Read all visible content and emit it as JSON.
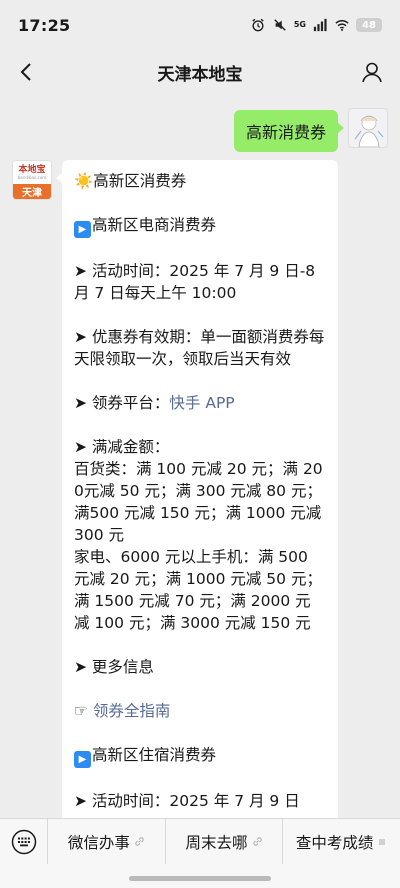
{
  "status": {
    "time": "17:25",
    "signal": "5G",
    "battery": "48"
  },
  "nav": {
    "title": "天津本地宝"
  },
  "outgoing": {
    "text": "高新消费券"
  },
  "bot_avatar": {
    "brand": "本地宝",
    "brand_sub": "bendibao.com",
    "city": "天津"
  },
  "message": {
    "p1": "☀️高新区消费券",
    "p2": "高新区电商消费券",
    "p3": "➤ 活动时间：2025 年 7 月 9 日-8 月 7 日每天上午 10:00",
    "p4": "➤ 优惠券有效期：单一面额消费券每天限领取一次，领取后当天有效",
    "p5_prefix": "➤ 领券平台：",
    "p5_link": "快手 APP",
    "p6_title": "➤ 满减金额：",
    "p6_line1": "百货类：满 100 元减 20 元；满 200元减 50 元；满 300 元减 80 元；满500 元减 150 元；满 1000 元减 300 元",
    "p6_line2": "家电、6000 元以上手机：满 500 元减 20 元；满 1000 元减 50 元；满 1500 元减 70 元；满 2000 元减 100 元；满 3000 元减 150 元",
    "p7": "➤ 更多信息",
    "p8_hand": "☞",
    "p8_link": "领券全指南",
    "p9": "高新区住宿消费券",
    "p10_partial": "➤ 活动时间：2025 年 7 月 9 日"
  },
  "menu": {
    "items": [
      {
        "label": "微信办事"
      },
      {
        "label": "周末去哪"
      },
      {
        "label": "查中考成绩"
      }
    ]
  }
}
